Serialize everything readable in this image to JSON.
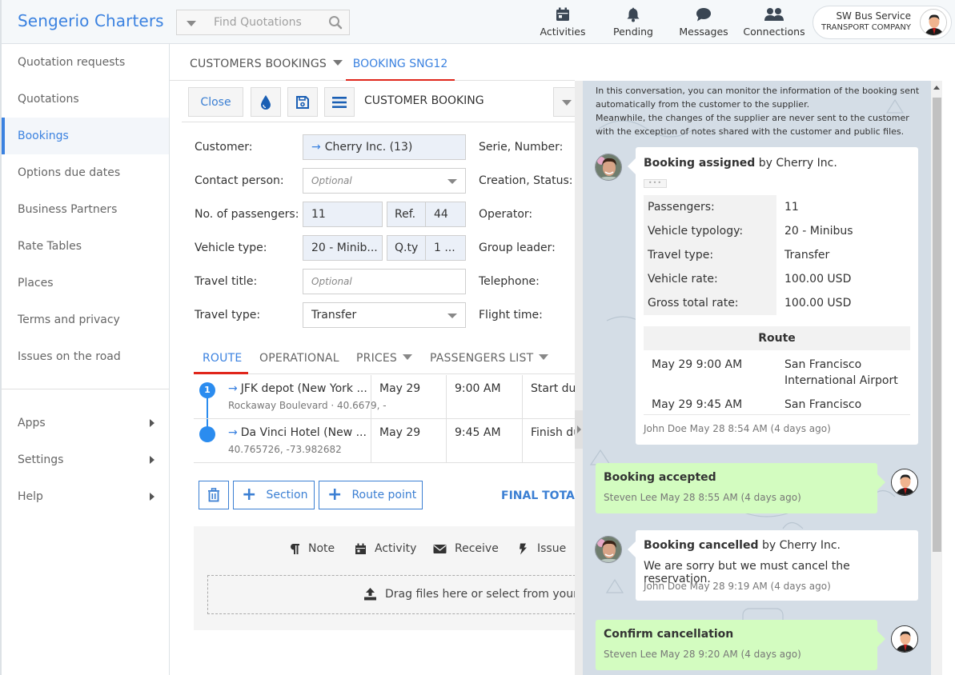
{
  "header": {
    "brand": "Sengerio Charters",
    "search_placeholder": "Find Quotations",
    "nav": [
      {
        "label": "Activities",
        "icon": "calendar-icon"
      },
      {
        "label": "Pending",
        "icon": "bell-icon"
      },
      {
        "label": "Messages",
        "icon": "chat-bubble-icon"
      },
      {
        "label": "Connections",
        "icon": "users-icon"
      }
    ],
    "user": {
      "name": "SW Bus Service",
      "role": "TRANSPORT COMPANY"
    }
  },
  "sidebar": {
    "items": [
      {
        "label": "Quotation requests"
      },
      {
        "label": "Quotations"
      },
      {
        "label": "Bookings",
        "active": true
      },
      {
        "label": "Options due dates"
      },
      {
        "label": "Business Partners"
      },
      {
        "label": "Rate Tables"
      },
      {
        "label": "Places"
      },
      {
        "label": "Terms and privacy"
      },
      {
        "label": "Issues on the road"
      }
    ],
    "bottom": [
      {
        "label": "Apps"
      },
      {
        "label": "Settings"
      },
      {
        "label": "Help"
      }
    ]
  },
  "tabs": {
    "list": "CUSTOMERS BOOKINGS",
    "active": "BOOKING SNG12"
  },
  "toolbar": {
    "close": "Close",
    "title": "CUSTOMER BOOKING"
  },
  "form": {
    "customer_label": "Customer:",
    "customer_value": "Cherry Inc. (13)",
    "contact_label": "Contact person:",
    "contact_placeholder": "Optional",
    "passengers_label": "No. of passengers:",
    "passengers_value": "11",
    "ref_label": "Ref.",
    "ref_value": "44",
    "vehicle_label": "Vehicle type:",
    "vehicle_value": "20 - Minib...",
    "qty_label": "Q.ty",
    "qty_value": "1 ...",
    "title_label": "Travel title:",
    "title_placeholder": "Optional",
    "type_label": "Travel type:",
    "type_value": "Transfer",
    "right_labels": [
      "Serie, Number:",
      "Creation, Status:",
      "Operator:",
      "Group leader:",
      "Telephone:",
      "Flight time:"
    ]
  },
  "subtabs": [
    {
      "label": "ROUTE",
      "active": true
    },
    {
      "label": "OPERATIONAL"
    },
    {
      "label": "PRICES"
    },
    {
      "label": "PASSENGERS LIST"
    }
  ],
  "route": [
    {
      "index": "1",
      "name": "JFK depot (New York ...",
      "sub": "Rockaway Boulevard · 40.6679, -",
      "date": "May 29",
      "time": "9:00 AM",
      "note": "Start duty"
    },
    {
      "index": "",
      "name": "Da Vinci Hotel (New ...",
      "sub": "40.765726, -73.982682",
      "date": "May 29",
      "time": "9:45 AM",
      "note": "Finish duty"
    }
  ],
  "actions": {
    "section": "Section",
    "route_point": "Route point",
    "final_total": "FINAL TOTAL"
  },
  "notes": {
    "buttons": [
      {
        "label": "Note",
        "icon": "paragraph-icon"
      },
      {
        "label": "Activity",
        "icon": "calendar-icon"
      },
      {
        "label": "Receive",
        "icon": "envelope-icon"
      },
      {
        "label": "Issue",
        "icon": "bolt-icon"
      }
    ],
    "drop": "Drag files here or select from your computer"
  },
  "chat": {
    "intro": "In this conversation, you can monitor the information of the booking sent automatically from the customer to the supplier.\nMeanwhile, the changes of the supplier are never sent to the customer with the exception of notes shared with the customer and public files.",
    "assigned": {
      "title_bold": "Booking assigned",
      "title_rest": " by Cherry Inc.",
      "details": [
        {
          "k": "Passengers:",
          "v": "11"
        },
        {
          "k": "Vehicle typology:",
          "v": "20 - Minibus"
        },
        {
          "k": "Travel type:",
          "v": "Transfer"
        },
        {
          "k": "Vehicle rate:",
          "v": "100.00 USD"
        },
        {
          "k": "Gross total rate:",
          "v": "100.00 USD"
        }
      ],
      "route_header": "Route",
      "route": [
        {
          "when": "May 29 9:00 AM",
          "place": "San Francisco International Airport"
        },
        {
          "when": "May 29 9:45 AM",
          "place": "San Francisco"
        }
      ],
      "meta": "John Doe May 28 8:54 AM (4 days ago)"
    },
    "accepted": {
      "title": "Booking accepted",
      "meta": "Steven Lee May 28 8:55 AM (4 days ago)"
    },
    "cancelled": {
      "title_bold": "Booking cancelled",
      "title_rest": " by Cherry Inc.",
      "body": "We are sorry but we must cancel the reservation.",
      "meta": "John Doe May 28 9:19 AM (4 days ago)"
    },
    "confirm": {
      "title": "Confirm cancellation",
      "meta": "Steven Lee May 28 9:20 AM (4 days ago)"
    }
  },
  "colors": {
    "accent": "#3b82e0",
    "active_tab_underline": "#e0261b",
    "green_bubble": "#d3fcc0",
    "chat_bg": "#d4dde6"
  }
}
